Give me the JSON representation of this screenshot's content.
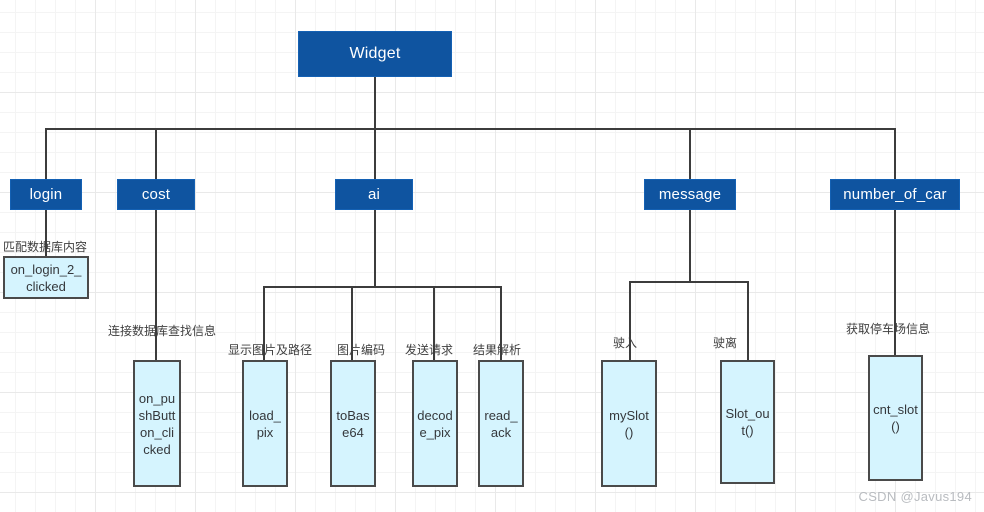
{
  "diagram": {
    "title": "Widget",
    "root": {
      "label": "Widget"
    },
    "level2": [
      {
        "label": "login"
      },
      {
        "label": "cost"
      },
      {
        "label": "ai"
      },
      {
        "label": "message"
      },
      {
        "label": "number_of_car"
      }
    ],
    "edge_labels": {
      "login_leaf": "匹配数据库内容",
      "cost_leaf": "连接数据库查找信息",
      "ai_leaf_1": "显示图片及路径",
      "ai_leaf_2": "图片编码",
      "ai_leaf_3": "发送请求",
      "ai_leaf_4": "结果解析",
      "message_leaf_1": "驶入",
      "message_leaf_2": "驶离",
      "number_of_car_leaf": "获取停车场信息"
    },
    "leaves": [
      {
        "label": "on_login_2_clicked"
      },
      {
        "label": "on_pushButton_clicked"
      },
      {
        "label": "load_pix"
      },
      {
        "label": "toBase64"
      },
      {
        "label": "decode_pix"
      },
      {
        "label": "read_ack"
      },
      {
        "label": "mySlot()"
      },
      {
        "label": "Slot_out()"
      },
      {
        "label": "cnt_slot()"
      }
    ],
    "watermark": "CSDN @Javus194",
    "colors": {
      "node_fill": "#0f54a0",
      "leaf_fill": "#d5f4fe",
      "leaf_border": "#4a4a4a",
      "connector": "#3c3c3c",
      "node_text": "#ffffff",
      "leaf_text": "#35383c",
      "watermark": "#b9bcc0",
      "grid_minor": "#f4f4f4",
      "grid_major": "#e9e9e9"
    }
  }
}
